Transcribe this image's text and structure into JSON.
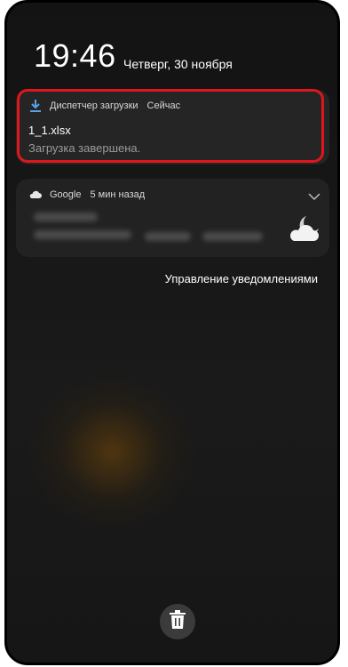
{
  "status": {
    "time": "19:46",
    "date": "Четверг, 30 ноября"
  },
  "download_notification": {
    "app_name": "Диспетчер загрузки",
    "time": "Сейчас",
    "file_name": "1_1.xlsx",
    "status": "Загрузка завершена.",
    "icon": "download-icon",
    "highlight_color": "#e0161b"
  },
  "google_notification": {
    "app_name": "Google",
    "time": "5 мин назад",
    "icon": "cloud-icon",
    "expand_icon": "chevron-down-icon",
    "weather_icon": "cloud-moon-icon"
  },
  "manage_label": "Управление уведомлениями",
  "clear_button_icon": "trash-icon"
}
